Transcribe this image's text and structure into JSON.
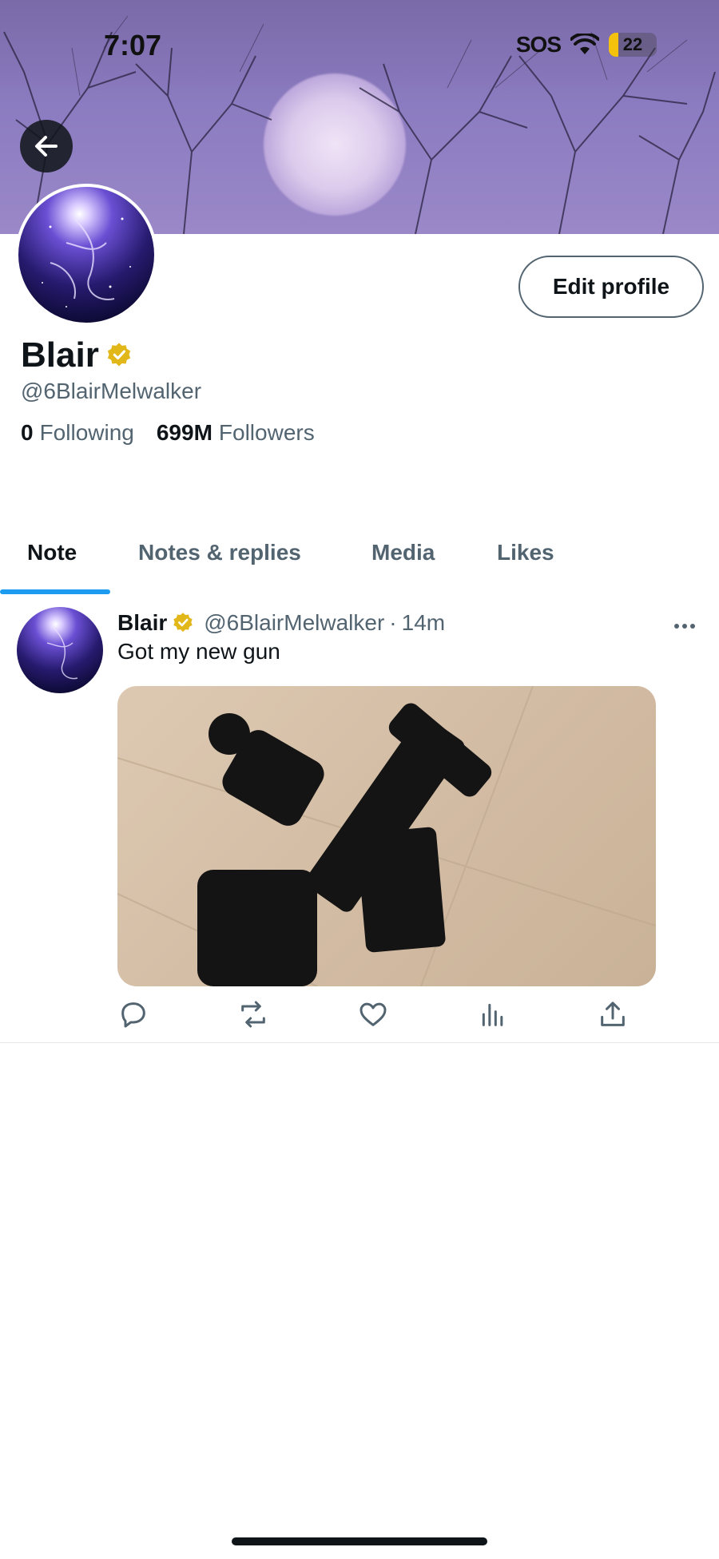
{
  "status_bar": {
    "time": "7:07",
    "sos": "SOS",
    "battery": "22"
  },
  "profile": {
    "display_name": "Blair",
    "handle": "@6BlairMelwalker",
    "following_count": "0",
    "following_label": "Following",
    "followers_count": "699M",
    "followers_label": "Followers",
    "edit_button": "Edit profile"
  },
  "tabs": [
    {
      "label": "Note",
      "active": true
    },
    {
      "label": "Notes & replies",
      "active": false
    },
    {
      "label": "Media",
      "active": false
    },
    {
      "label": "Likes",
      "active": false
    }
  ],
  "post": {
    "name": "Blair",
    "handle": "@6BlairMelwalker",
    "separator": "·",
    "time": "14m",
    "text": "Got my new gun",
    "more_icon": "more-horizontal-icon"
  },
  "actions": [
    "reply-icon",
    "repost-icon",
    "like-icon",
    "views-icon",
    "share-icon"
  ],
  "colors": {
    "accent": "#1d9bf0",
    "verified": "#e2b719",
    "muted": "#536471"
  }
}
